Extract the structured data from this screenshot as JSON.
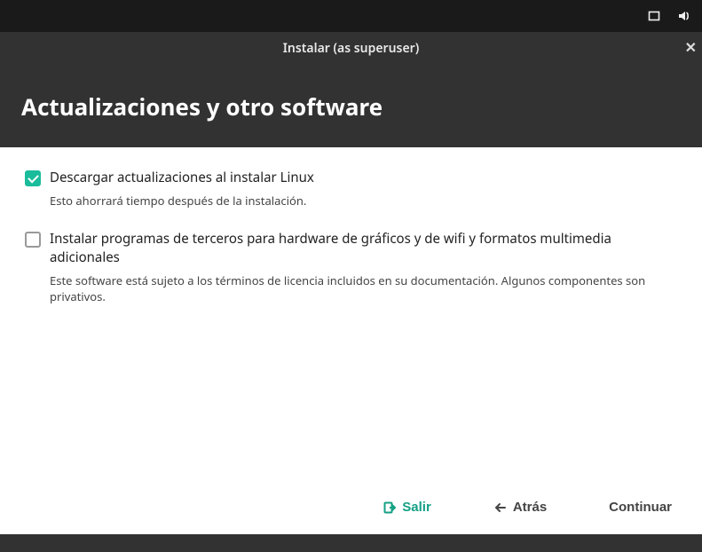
{
  "top_panel": {},
  "window": {
    "title": "Instalar (as superuser)"
  },
  "header": {
    "title": "Actualizaciones y otro software"
  },
  "options": [
    {
      "checked": true,
      "label": "Descargar actualizaciones al instalar Linux",
      "description": "Esto ahorrará tiempo después de la instalación."
    },
    {
      "checked": false,
      "label": "Instalar programas de terceros para hardware de gráficos y de wifi y formatos multimedia adicionales",
      "description": "Este software está sujeto a los términos de licencia incluidos en su documentación. Algunos componentes son privativos."
    }
  ],
  "buttons": {
    "quit": "Salir",
    "back": "Atrás",
    "continue": "Continuar"
  },
  "colors": {
    "accent": "#1abc9c",
    "header_bg": "#323232"
  }
}
